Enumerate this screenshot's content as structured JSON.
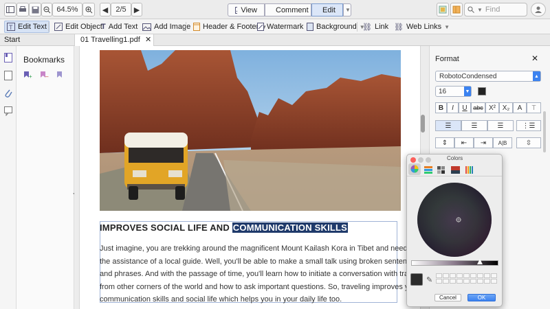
{
  "toolbar": {
    "zoom": "64.5%",
    "page": "2/5",
    "modes": [
      "View",
      "Comment",
      "Edit"
    ],
    "active_mode": "Edit",
    "search_placeholder": "Find"
  },
  "edit_tools": [
    "Edit Text",
    "Edit Object",
    "Add Text",
    "Add Image",
    "Header & Footer",
    "Watermark",
    "Background",
    "Link",
    "Web Links"
  ],
  "tabs": {
    "start": "Start",
    "doc": "01 Travelling1.pdf"
  },
  "sidebar": {
    "title": "Bookmarks"
  },
  "document": {
    "heading_plain": "IMPROVES SOCIAL LIFE AND ",
    "heading_selected": "COMMUNICATION SKILLS",
    "lines": [
      "Just imagine, you are trekking around the magnificent Mount Kailash Kora in Tibet and need to take",
      "the assistance of a local guide. Well, you'll be able to make a small talk using broken sentences",
      "and phrases. And with the passage of time, you'll learn how to initiate a conversation with travelers",
      "from other corners of the world and how to ask important questions. So, traveling improves your",
      "communication skills and social life which helps you in your daily life too."
    ]
  },
  "format_panel": {
    "title": "Format",
    "font": "RobotoCondensed",
    "size": "16",
    "style_buttons": [
      "B",
      "I",
      "U",
      "abc",
      "X²",
      "X₂",
      "A",
      "T"
    ]
  },
  "colors_dialog": {
    "title": "Colors",
    "cancel": "Cancel",
    "ok": "OK"
  },
  "colors": {
    "accent": "#3b82f0",
    "selection": "#1f3a6b"
  }
}
